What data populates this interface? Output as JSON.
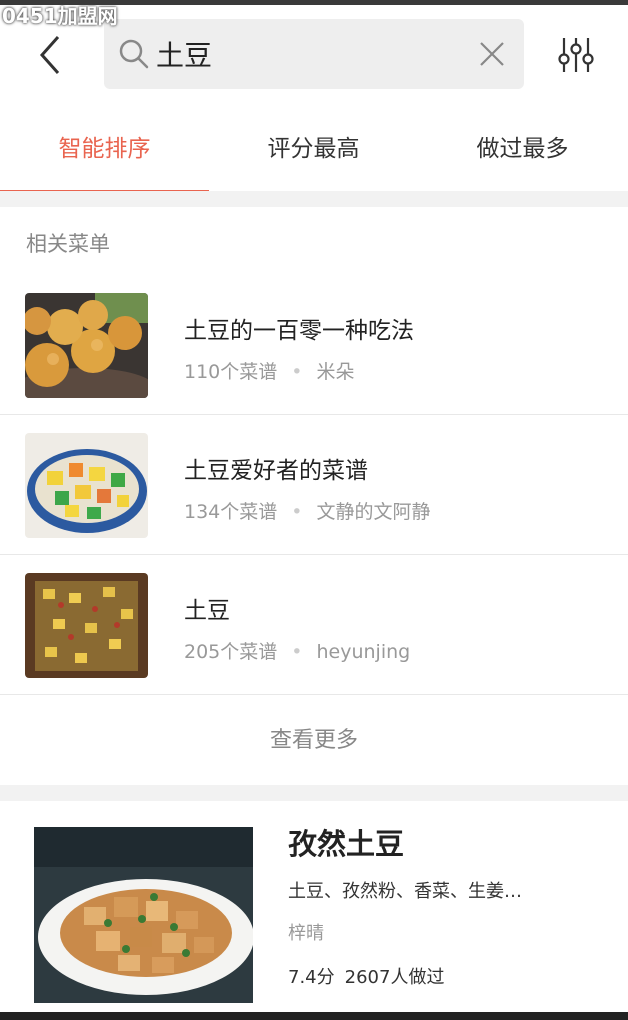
{
  "watermark": "0451加盟网",
  "header": {
    "back_icon": "chevron-left-icon",
    "search": {
      "icon": "search-icon",
      "value": "土豆",
      "clear_icon": "close-icon"
    },
    "filter_icon": "sliders-icon"
  },
  "tabs": [
    {
      "label": "智能排序",
      "active": true
    },
    {
      "label": "评分最高",
      "active": false
    },
    {
      "label": "做过最多",
      "active": false
    }
  ],
  "colors": {
    "accent": "#e9644f",
    "section_gap": "#f2f2f2"
  },
  "related_menus": {
    "title": "相关菜单",
    "items": [
      {
        "title": "土豆的一百零一种吃法",
        "count": "110个菜谱",
        "author": "米朵",
        "thumb": "potato-balls-photo"
      },
      {
        "title": "土豆爱好者的菜谱",
        "count": "134个菜谱",
        "author": "文静的文阿静",
        "thumb": "diced-vegetables-bowl-photo"
      },
      {
        "title": "土豆",
        "count": "205个菜谱",
        "author": "heyunjing",
        "thumb": "potato-mince-photo"
      }
    ],
    "see_more": "查看更多"
  },
  "recipe": {
    "name": "孜然土豆",
    "ingredients": "土豆、孜然粉、香菜、生姜…",
    "author": "梓晴",
    "rating": "7.4分",
    "made_count": "2607人做过",
    "photo": "cumin-potato-photo"
  }
}
